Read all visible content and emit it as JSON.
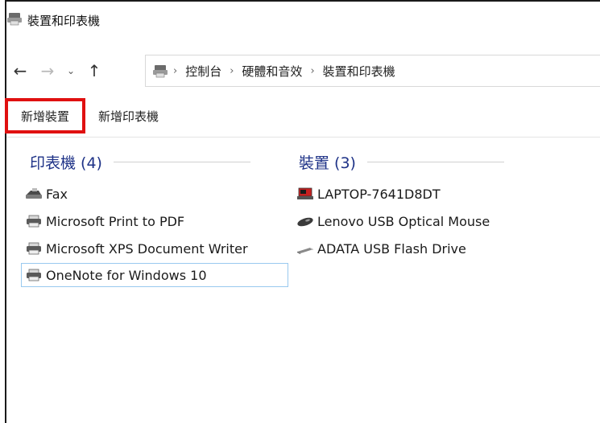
{
  "window": {
    "title": "裝置和印表機"
  },
  "navigation": {
    "back": "←",
    "forward": "→",
    "recent": "⌄",
    "up": "↑"
  },
  "breadcrumb": {
    "items": [
      "控制台",
      "硬體和音效",
      "裝置和印表機"
    ],
    "separator": "›"
  },
  "toolbar": {
    "add_device": "新增裝置",
    "add_printer": "新增印表機"
  },
  "groups": {
    "printers": {
      "title": "印表機 (4)",
      "items": [
        {
          "label": "Fax",
          "icon": "fax-icon"
        },
        {
          "label": "Microsoft Print to PDF",
          "icon": "printer-icon"
        },
        {
          "label": "Microsoft XPS Document Writer",
          "icon": "printer-icon"
        },
        {
          "label": "OneNote for Windows 10",
          "icon": "printer-icon",
          "selected": true
        }
      ]
    },
    "devices": {
      "title": "裝置 (3)",
      "items": [
        {
          "label": "LAPTOP-7641D8DT",
          "icon": "laptop-icon"
        },
        {
          "label": "Lenovo USB Optical Mouse",
          "icon": "mouse-icon"
        },
        {
          "label": "ADATA USB Flash Drive",
          "icon": "usb-drive-icon"
        }
      ]
    }
  },
  "colors": {
    "group_title": "#1e3287",
    "highlight_border": "#e01010",
    "selection_border": "#99c9ef"
  }
}
